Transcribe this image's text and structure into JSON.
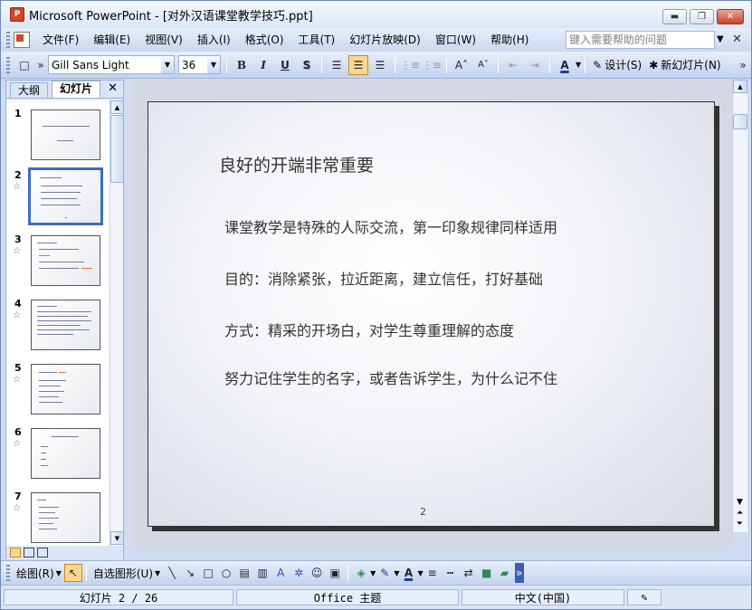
{
  "window": {
    "title": "Microsoft PowerPoint - [对外汉语课堂教学技巧.ppt]",
    "app_icon_text": "P"
  },
  "menubar": {
    "items": [
      "文件(F)",
      "编辑(E)",
      "视图(V)",
      "插入(I)",
      "格式(O)",
      "工具(T)",
      "幻灯片放映(D)",
      "窗口(W)",
      "帮助(H)"
    ],
    "help_placeholder": "键入需要帮助的问题"
  },
  "toolbar": {
    "font_name": "Gill Sans Light",
    "font_size": "36",
    "bold": "B",
    "italic": "I",
    "underline": "U",
    "shadow": "S",
    "design_label": "设计(S)",
    "new_slide_label": "新幻灯片(N)"
  },
  "left_pane": {
    "tabs": [
      "大纲",
      "幻灯片"
    ],
    "active_tab": "幻灯片",
    "slides": [
      {
        "num": "1",
        "star": ""
      },
      {
        "num": "2",
        "star": "☆"
      },
      {
        "num": "3",
        "star": "☆"
      },
      {
        "num": "4",
        "star": "☆"
      },
      {
        "num": "5",
        "star": "☆"
      },
      {
        "num": "6",
        "star": "☆"
      },
      {
        "num": "7",
        "star": "☆"
      }
    ],
    "selected_slide": 2
  },
  "slide": {
    "title": "良好的开端非常重要",
    "lines": [
      "课堂教学是特殊的人际交流，第一印象规律同样适用",
      "目的：消除紧张，拉近距离，建立信任，打好基础",
      "方式：精采的开场白，对学生尊重理解的态度",
      "努力记住学生的名字，或者告诉学生，为什么记不住"
    ],
    "number": "2"
  },
  "drawbar": {
    "draw_label": "绘图(R)",
    "autoshape_label": "自选图形(U)"
  },
  "status": {
    "slide_pos": "幻灯片 2 / 26",
    "theme": "Office 主题",
    "language": "中文(中国)"
  },
  "colors": {
    "accent": "#fbd78d",
    "selected_border": "#3b6cc4",
    "title_red": "#d24726"
  }
}
